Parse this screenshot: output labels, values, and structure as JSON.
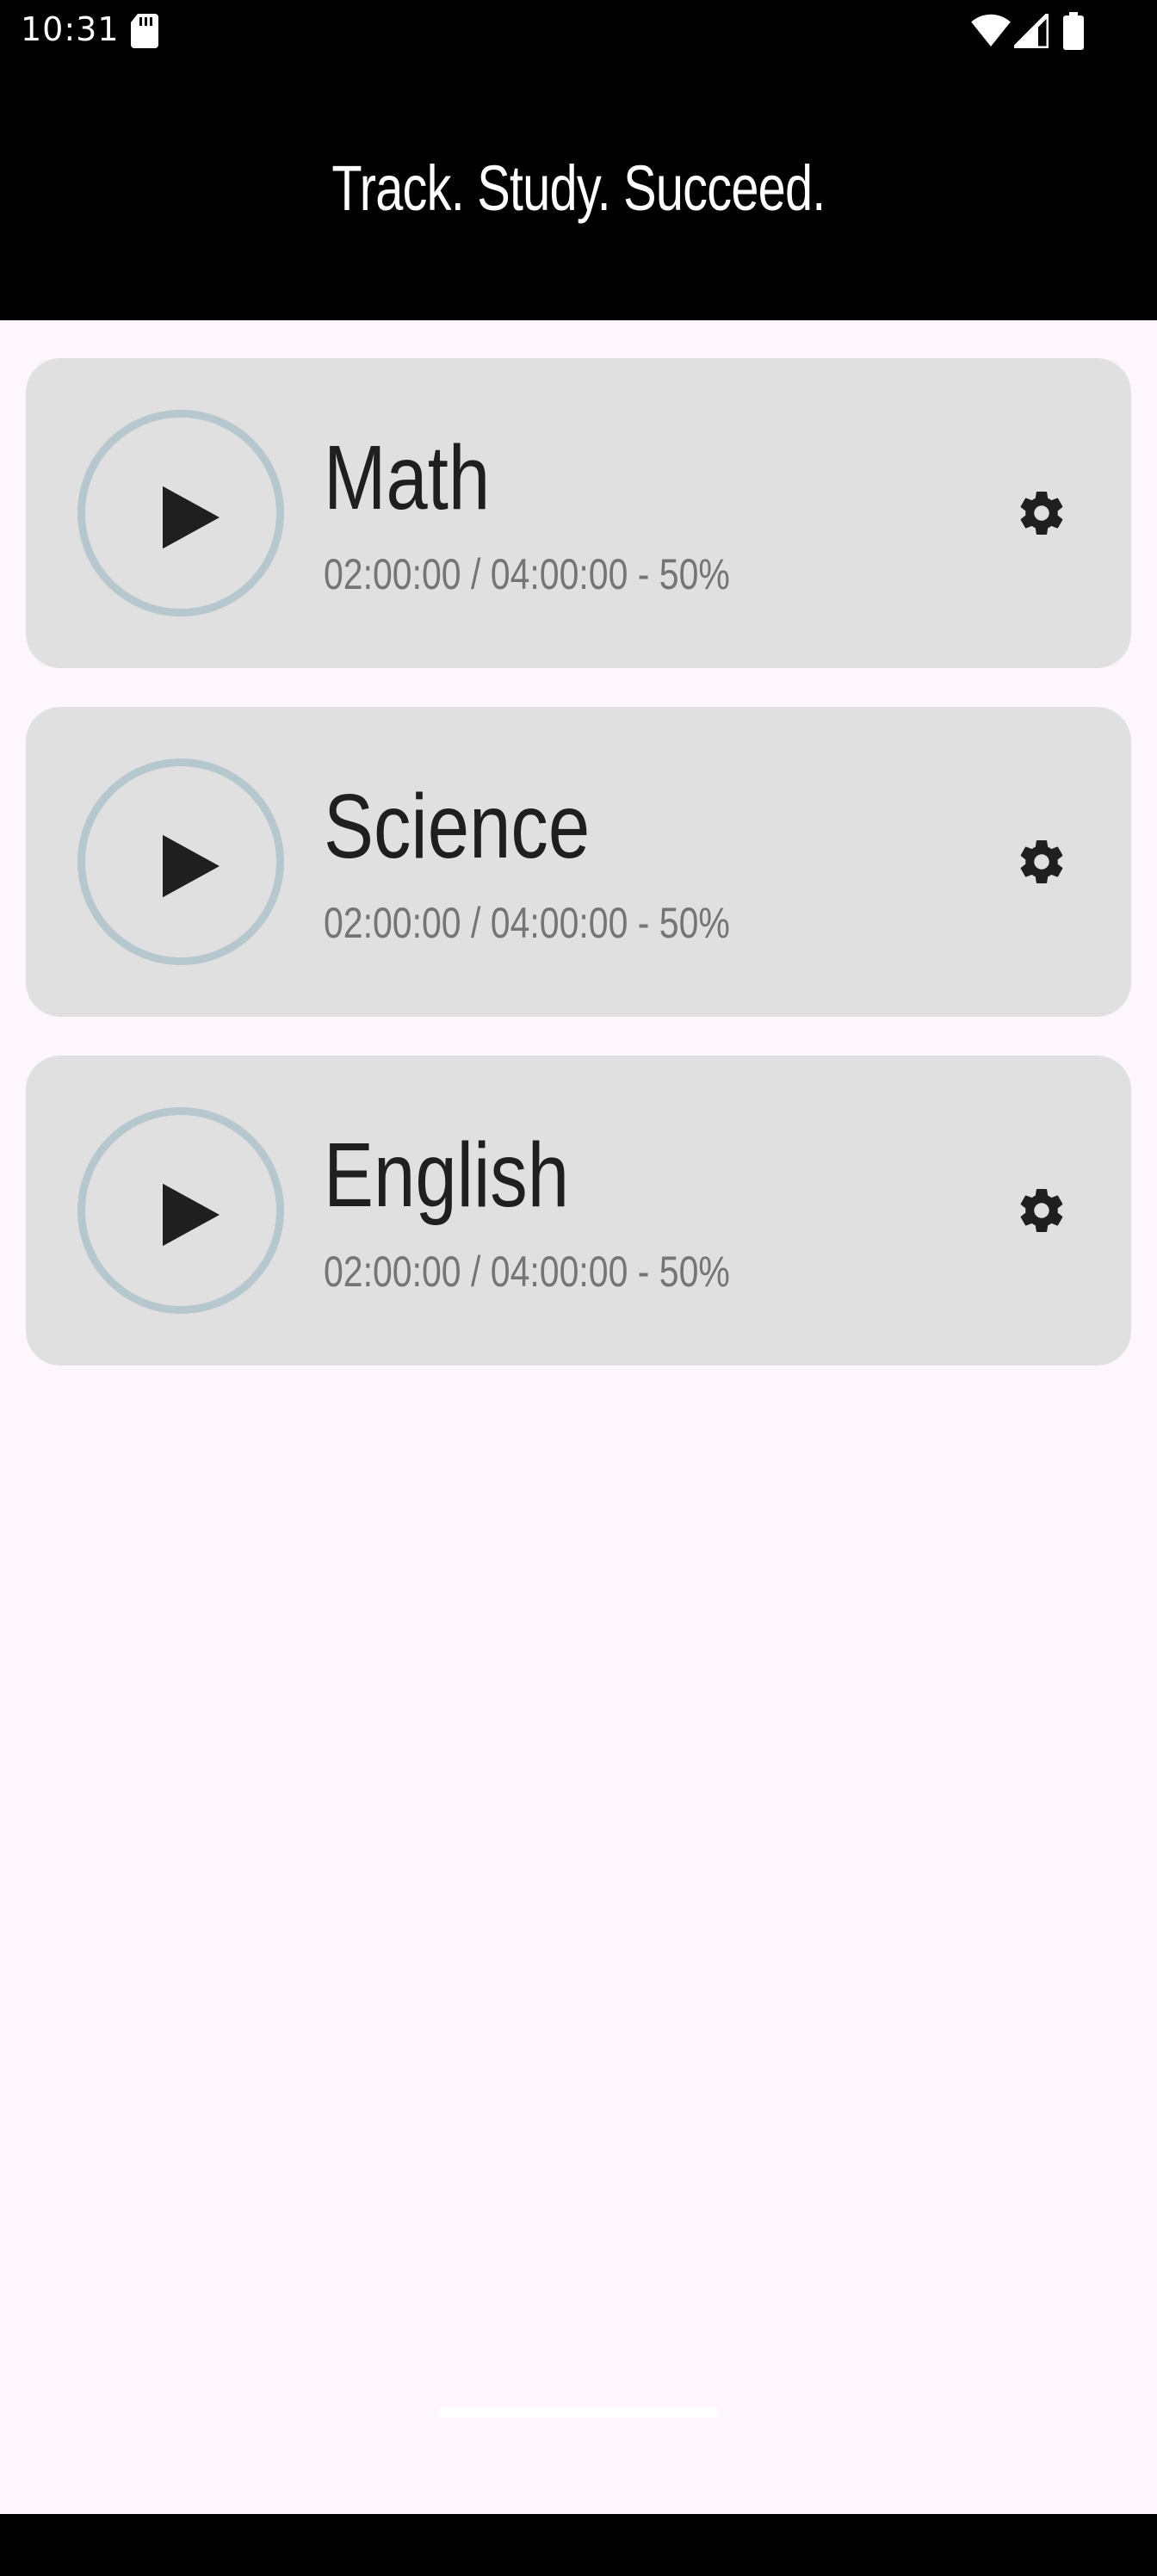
{
  "status_bar": {
    "time": "10:31",
    "icons": [
      "sd-card-icon",
      "wifi-icon",
      "signal-icon",
      "battery-icon"
    ]
  },
  "app_bar": {
    "title": "Track. Study. Succeed."
  },
  "subjects": [
    {
      "name": "Math",
      "progress_text": "02:00:00 / 04:00:00 - 50%"
    },
    {
      "name": "Science",
      "progress_text": "02:00:00 / 04:00:00 - 50%"
    },
    {
      "name": "English",
      "progress_text": "02:00:00 / 04:00:00 - 50%"
    }
  ],
  "colors": {
    "background": "#fdf6fd",
    "card": "#e0e0e0",
    "ring": "#b6c7cd",
    "bar": "#000000"
  }
}
